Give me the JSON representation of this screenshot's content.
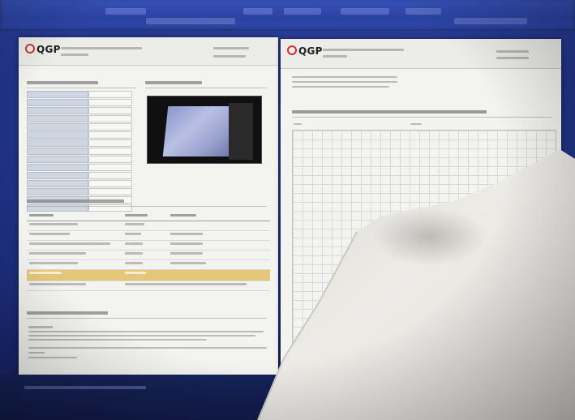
{
  "scene": {
    "background_color": "#22348a",
    "document_paper_color": "#f3f3f0",
    "highlight_row_color": "#e6c77a",
    "foreground_paper_color": "#e7e6df"
  },
  "left_document": {
    "logo_text": "QGP",
    "icons": [
      "qgp-logo-icon"
    ]
  },
  "right_document": {
    "logo_text": "QGP"
  }
}
